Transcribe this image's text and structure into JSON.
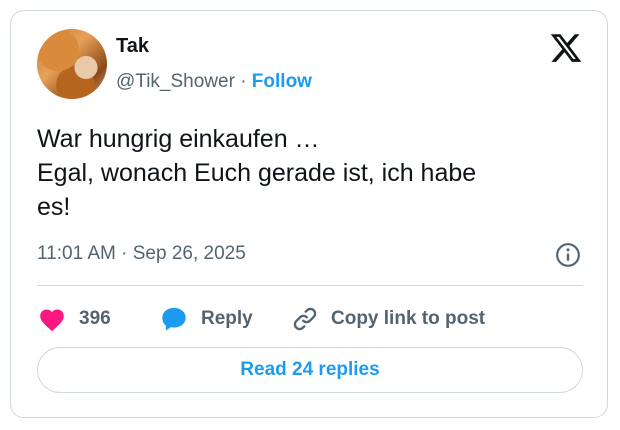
{
  "author": {
    "name": "Tak",
    "handle": "@Tik_Shower",
    "separator": "·",
    "follow_label": "Follow"
  },
  "tweet": {
    "lines": [
      "War hungrig einkaufen …",
      "Egal, wonach Euch gerade ist, ich habe",
      "es!"
    ],
    "timestamp": "11:01 AM · Sep 26, 2025"
  },
  "actions": {
    "likes_count": "396",
    "reply_label": "Reply",
    "copy_link_label": "Copy link to post"
  },
  "read_replies_label": "Read 24 replies",
  "icons": {
    "logo": "x-logo-icon",
    "info": "info-icon",
    "like": "heart-icon",
    "reply": "speech-bubble-icon",
    "copy_link": "link-icon"
  },
  "colors": {
    "like": "#f91880",
    "reply": "#1d9bf0",
    "accent": "#1d9bf0",
    "secondary_text": "#536471"
  }
}
